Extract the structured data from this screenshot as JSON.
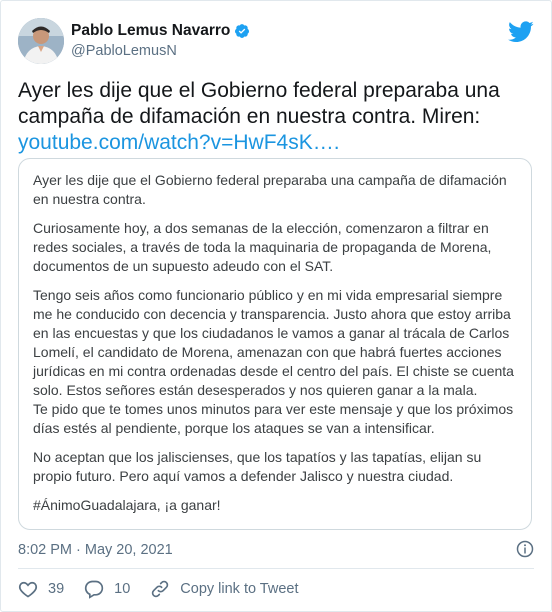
{
  "author": {
    "name": "Pablo Lemus Navarro",
    "handle": "@PabloLemusN",
    "verified_icon": "verified-badge-icon",
    "avatar_icon": "profile-photo"
  },
  "brand": {
    "icon": "twitter-bird-icon",
    "color": "#1da1f2"
  },
  "tweet": {
    "text": "Ayer les dije que el Gobierno federal preparaba una campaña de difamación en nuestra contra. Miren: ",
    "link": "youtube.com/watch?v=HwF4sK…."
  },
  "embedded_text": {
    "p1": "Ayer les dije que el Gobierno federal preparaba una campaña de difamación en nuestra contra.",
    "p2": "Curiosamente hoy, a dos semanas de la elección, comenzaron a filtrar en redes sociales, a través de toda la maquinaria de propaganda de Morena, documentos de un supuesto adeudo con el SAT.",
    "p3": "Tengo seis años como funcionario público y en mi vida empresarial siempre me he conducido con decencia y transparencia. Justo ahora que estoy arriba en las encuestas y que los ciudadanos le vamos a ganar al trácala de Carlos Lomelí, el candidato de Morena, amenazan con que habrá fuertes acciones jurídicas en mi contra ordenadas desde el centro del país. El chiste se cuenta solo. Estos señores están desesperados y nos quieren ganar a la mala.",
    "p4": "Te pido que te tomes unos minutos para ver este mensaje y que los próximos días estés al pendiente, porque los ataques se van a intensificar.",
    "p5": "No aceptan que los jaliscienses, que los tapatíos y las tapatías, elijan su propio futuro. Pero aquí vamos a defender Jalisco y nuestra ciudad.",
    "p6": "#ÁnimoGuadalajara, ¡a ganar!"
  },
  "meta": {
    "timestamp": "8:02 PM · May 20, 2021",
    "info_icon": "info-icon"
  },
  "actions": {
    "likes": "39",
    "like_icon": "heart-icon",
    "replies": "10",
    "reply_icon": "reply-icon",
    "copy_link": "Copy link to Tweet",
    "copy_icon": "link-icon"
  }
}
